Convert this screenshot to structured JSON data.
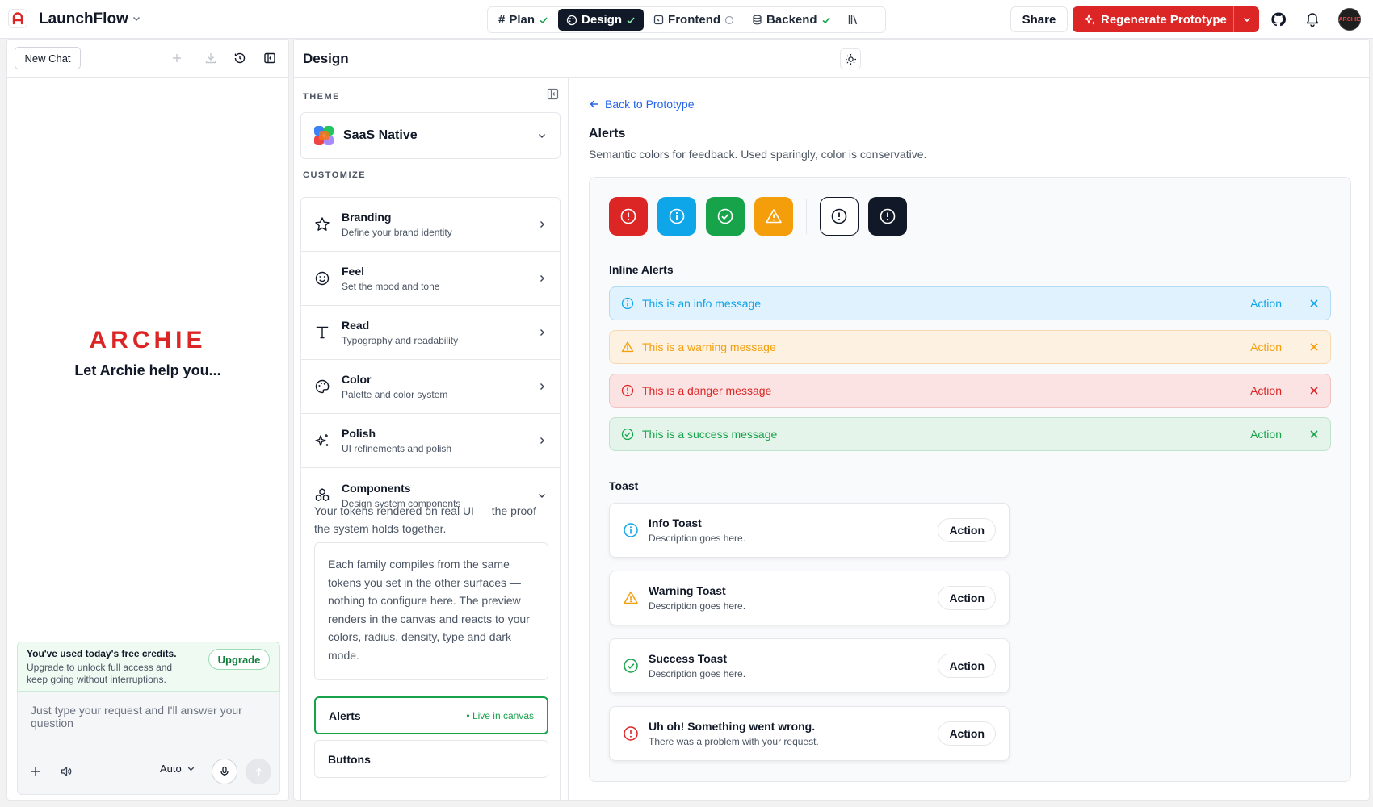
{
  "app": {
    "name": "LaunchFlow"
  },
  "steps": [
    {
      "label": "Plan",
      "status": "done"
    },
    {
      "label": "Design",
      "status": "done",
      "active": true
    },
    {
      "label": "Frontend",
      "status": "pending"
    },
    {
      "label": "Backend",
      "status": "done"
    }
  ],
  "topbar": {
    "share_label": "Share",
    "regenerate_label": "Regenerate Prototype",
    "avatar_text": "ARCHIE"
  },
  "chat": {
    "new_chat_label": "New Chat",
    "brand": "ARCHIE",
    "tagline": "Let Archie help you...",
    "credits_title": "You've used today's free credits.",
    "credits_text": "Upgrade to unlock full access and keep going without interruptions.",
    "upgrade_label": "Upgrade",
    "input_placeholder": "Just type your request and I'll answer your question",
    "mode_label": "Auto"
  },
  "design": {
    "title": "Design",
    "theme_label": "THEME",
    "theme_name": "SaaS Native",
    "customize_label": "CUSTOMIZE",
    "items": [
      {
        "title": "Branding",
        "sub": "Define your brand identity",
        "icon": "star-icon"
      },
      {
        "title": "Feel",
        "sub": "Set the mood and tone",
        "icon": "smile-icon"
      },
      {
        "title": "Read",
        "sub": "Typography and readability",
        "icon": "type-icon"
      },
      {
        "title": "Color",
        "sub": "Palette and color system",
        "icon": "palette-icon"
      },
      {
        "title": "Polish",
        "sub": "UI refinements and polish",
        "icon": "sparkles-icon"
      },
      {
        "title": "Components",
        "sub": "Design system components",
        "icon": "components-icon"
      }
    ],
    "components_desc": "Your tokens rendered on real UI — the proof the system holds together.",
    "components_note": "Each family compiles from the same tokens you set in the other surfaces — nothing to configure here. The preview renders in the canvas and reacts to your colors, radius, density, type and dark mode.",
    "component_rows": [
      {
        "label": "Alerts",
        "badge": "• Live in canvas"
      },
      {
        "label": "Buttons"
      }
    ]
  },
  "canvas": {
    "back_label": "Back to Prototype",
    "title": "Alerts",
    "subtitle": "Semantic colors for feedback. Used sparingly, color is conservative.",
    "inline_heading": "Inline Alerts",
    "toast_heading": "Toast",
    "colors": {
      "danger": "#dc2626",
      "info": "#0ea5e9",
      "success": "#16a34a",
      "warning": "#f59e0b",
      "dark": "#111827"
    },
    "inline_alerts": [
      {
        "type": "info",
        "message": "This is an info message",
        "action": "Action"
      },
      {
        "type": "warning",
        "message": "This is a warning message",
        "action": "Action"
      },
      {
        "type": "danger",
        "message": "This is a danger message",
        "action": "Action"
      },
      {
        "type": "success",
        "message": "This is a success message",
        "action": "Action"
      }
    ],
    "toasts": [
      {
        "type": "info",
        "title": "Info Toast",
        "desc": "Description goes here.",
        "action": "Action"
      },
      {
        "type": "warning",
        "title": "Warning Toast",
        "desc": "Description goes here.",
        "action": "Action"
      },
      {
        "type": "success",
        "title": "Success Toast",
        "desc": "Description goes here.",
        "action": "Action"
      },
      {
        "type": "danger",
        "title": "Uh oh! Something went wrong.",
        "desc": "There was a problem with your request.",
        "action": "Action"
      }
    ]
  }
}
